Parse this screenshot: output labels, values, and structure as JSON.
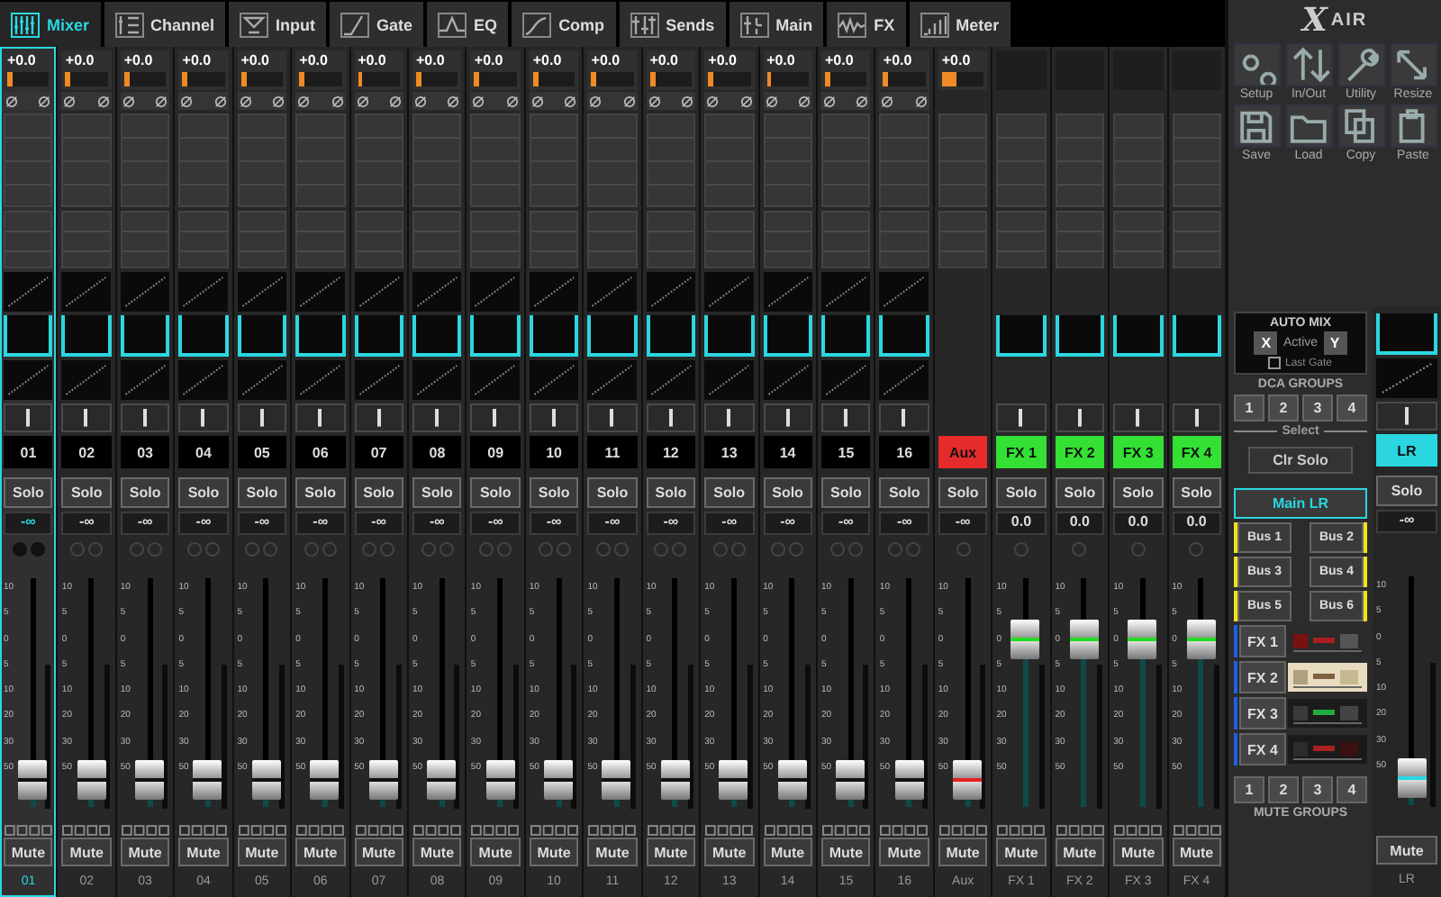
{
  "tabs": [
    {
      "label": "Mixer",
      "kind": "mixer",
      "selected": true
    },
    {
      "label": "Channel",
      "kind": "channel",
      "selected": false
    },
    {
      "label": "Input",
      "kind": "input",
      "selected": false
    },
    {
      "label": "Gate",
      "kind": "gate",
      "selected": false
    },
    {
      "label": "EQ",
      "kind": "eq",
      "selected": false
    },
    {
      "label": "Comp",
      "kind": "comp",
      "selected": false
    },
    {
      "label": "Sends",
      "kind": "sends",
      "selected": false
    },
    {
      "label": "Main",
      "kind": "main",
      "selected": false
    },
    {
      "label": "FX",
      "kind": "fx",
      "selected": false
    },
    {
      "label": "Meter",
      "kind": "meter",
      "selected": false
    }
  ],
  "logo": {
    "mark": "X",
    "text": "AIR"
  },
  "tools": [
    {
      "label": "Setup",
      "kind": "setup"
    },
    {
      "label": "In/Out",
      "kind": "inout"
    },
    {
      "label": "Utility",
      "kind": "utility"
    },
    {
      "label": "Resize",
      "kind": "resize"
    },
    {
      "label": "Save",
      "kind": "save"
    },
    {
      "label": "Load",
      "kind": "load"
    },
    {
      "label": "Copy",
      "kind": "copy"
    },
    {
      "label": "Paste",
      "kind": "paste"
    }
  ],
  "strips": [
    {
      "kind": "input",
      "label": "01",
      "selected": true,
      "gain": "+0.0",
      "meter": {
        "level": 0.12
      },
      "solo": "Solo",
      "value": "-∞",
      "scale": [
        "10",
        "5",
        "0",
        "5",
        "10",
        "20",
        "30",
        "50"
      ],
      "fader": {
        "level": 0.12
      },
      "mute": "Mute",
      "name": "01"
    },
    {
      "kind": "input",
      "label": "02",
      "selected": false,
      "gain": "+0.0",
      "meter": {
        "level": 0.12
      },
      "solo": "Solo",
      "value": "-∞",
      "scale": [
        "10",
        "5",
        "0",
        "5",
        "10",
        "20",
        "30",
        "50"
      ],
      "fader": {
        "level": 0.12
      },
      "mute": "Mute",
      "name": "02"
    },
    {
      "kind": "input",
      "label": "03",
      "selected": false,
      "gain": "+0.0",
      "meter": {
        "level": 0.12
      },
      "solo": "Solo",
      "value": "-∞",
      "scale": [
        "10",
        "5",
        "0",
        "5",
        "10",
        "20",
        "30",
        "50"
      ],
      "fader": {
        "level": 0.12
      },
      "mute": "Mute",
      "name": "03"
    },
    {
      "kind": "input",
      "label": "04",
      "selected": false,
      "gain": "+0.0",
      "meter": {
        "level": 0.12
      },
      "solo": "Solo",
      "value": "-∞",
      "scale": [
        "10",
        "5",
        "0",
        "5",
        "10",
        "20",
        "30",
        "50"
      ],
      "fader": {
        "level": 0.12
      },
      "mute": "Mute",
      "name": "04"
    },
    {
      "kind": "input",
      "label": "05",
      "selected": false,
      "gain": "+0.0",
      "meter": {
        "level": 0.12
      },
      "solo": "Solo",
      "value": "-∞",
      "scale": [
        "10",
        "5",
        "0",
        "5",
        "10",
        "20",
        "30",
        "50"
      ],
      "fader": {
        "level": 0.12
      },
      "mute": "Mute",
      "name": "05"
    },
    {
      "kind": "input",
      "label": "06",
      "selected": false,
      "gain": "+0.0",
      "meter": {
        "level": 0.12
      },
      "solo": "Solo",
      "value": "-∞",
      "scale": [
        "10",
        "5",
        "0",
        "5",
        "10",
        "20",
        "30",
        "50"
      ],
      "fader": {
        "level": 0.12
      },
      "mute": "Mute",
      "name": "06"
    },
    {
      "kind": "input",
      "label": "07",
      "selected": false,
      "gain": "+0.0",
      "meter": {
        "level": 0.12
      },
      "solo": "Solo",
      "value": "-∞",
      "scale": [
        "10",
        "5",
        "0",
        "5",
        "10",
        "20",
        "30",
        "50"
      ],
      "fader": {
        "level": 0.12
      },
      "mute": "Mute",
      "name": "07"
    },
    {
      "kind": "input",
      "label": "08",
      "selected": false,
      "gain": "+0.0",
      "meter": {
        "level": 0.12
      },
      "solo": "Solo",
      "value": "-∞",
      "scale": [
        "10",
        "5",
        "0",
        "5",
        "10",
        "20",
        "30",
        "50"
      ],
      "fader": {
        "level": 0.12
      },
      "mute": "Mute",
      "name": "08"
    },
    {
      "kind": "input",
      "label": "09",
      "selected": false,
      "gain": "+0.0",
      "meter": {
        "level": 0.12
      },
      "solo": "Solo",
      "value": "-∞",
      "scale": [
        "10",
        "5",
        "0",
        "5",
        "10",
        "20",
        "30",
        "50"
      ],
      "fader": {
        "level": 0.12
      },
      "mute": "Mute",
      "name": "09"
    },
    {
      "kind": "input",
      "label": "10",
      "selected": false,
      "gain": "+0.0",
      "meter": {
        "level": 0.12
      },
      "solo": "Solo",
      "value": "-∞",
      "scale": [
        "10",
        "5",
        "0",
        "5",
        "10",
        "20",
        "30",
        "50"
      ],
      "fader": {
        "level": 0.12
      },
      "mute": "Mute",
      "name": "10"
    },
    {
      "kind": "input",
      "label": "11",
      "selected": false,
      "gain": "+0.0",
      "meter": {
        "level": 0.12
      },
      "solo": "Solo",
      "value": "-∞",
      "scale": [
        "10",
        "5",
        "0",
        "5",
        "10",
        "20",
        "30",
        "50"
      ],
      "fader": {
        "level": 0.12
      },
      "mute": "Mute",
      "name": "11"
    },
    {
      "kind": "input",
      "label": "12",
      "selected": false,
      "gain": "+0.0",
      "meter": {
        "level": 0.12
      },
      "solo": "Solo",
      "value": "-∞",
      "scale": [
        "10",
        "5",
        "0",
        "5",
        "10",
        "20",
        "30",
        "50"
      ],
      "fader": {
        "level": 0.12
      },
      "mute": "Mute",
      "name": "12"
    },
    {
      "kind": "input",
      "label": "13",
      "selected": false,
      "gain": "+0.0",
      "meter": {
        "level": 0.12
      },
      "solo": "Solo",
      "value": "-∞",
      "scale": [
        "10",
        "5",
        "0",
        "5",
        "10",
        "20",
        "30",
        "50"
      ],
      "fader": {
        "level": 0.12
      },
      "mute": "Mute",
      "name": "13"
    },
    {
      "kind": "input",
      "label": "14",
      "selected": false,
      "gain": "+0.0",
      "meter": {
        "level": 0.12
      },
      "solo": "Solo",
      "value": "-∞",
      "scale": [
        "10",
        "5",
        "0",
        "5",
        "10",
        "20",
        "30",
        "50"
      ],
      "fader": {
        "level": 0.12
      },
      "mute": "Mute",
      "name": "14"
    },
    {
      "kind": "input",
      "label": "15",
      "selected": false,
      "gain": "+0.0",
      "meter": {
        "level": 0.12
      },
      "solo": "Solo",
      "value": "-∞",
      "scale": [
        "10",
        "5",
        "0",
        "5",
        "10",
        "20",
        "30",
        "50"
      ],
      "fader": {
        "level": 0.12
      },
      "mute": "Mute",
      "name": "15"
    },
    {
      "kind": "input",
      "label": "16",
      "selected": false,
      "gain": "+0.0",
      "meter": {
        "level": 0.12
      },
      "solo": "Solo",
      "value": "-∞",
      "scale": [
        "10",
        "5",
        "0",
        "5",
        "10",
        "20",
        "30",
        "50"
      ],
      "fader": {
        "level": 0.12
      },
      "mute": "Mute",
      "name": "16"
    },
    {
      "kind": "aux",
      "label": "Aux",
      "selected": false,
      "gain": "+0.0",
      "meter": {
        "level": 0.35
      },
      "solo": "Solo",
      "value": "-∞",
      "scale": [
        "10",
        "5",
        "0",
        "5",
        "10",
        "20",
        "30",
        "50"
      ],
      "fader": {
        "level": 0.12
      },
      "mute": "Mute",
      "name": "Aux"
    },
    {
      "kind": "fx",
      "label": "FX 1",
      "selected": false,
      "solo": "Solo",
      "value": "0.0",
      "scale": [
        "10",
        "5",
        "0",
        "5",
        "10",
        "20",
        "30",
        "50"
      ],
      "fader": {
        "level": 0.73
      },
      "mute": "Mute",
      "name": "FX 1"
    },
    {
      "kind": "fx",
      "label": "FX 2",
      "selected": false,
      "solo": "Solo",
      "value": "0.0",
      "scale": [
        "10",
        "5",
        "0",
        "5",
        "10",
        "20",
        "30",
        "50"
      ],
      "fader": {
        "level": 0.73
      },
      "mute": "Mute",
      "name": "FX 2"
    },
    {
      "kind": "fx",
      "label": "FX 3",
      "selected": false,
      "solo": "Solo",
      "value": "0.0",
      "scale": [
        "10",
        "5",
        "0",
        "5",
        "10",
        "20",
        "30",
        "50"
      ],
      "fader": {
        "level": 0.73
      },
      "mute": "Mute",
      "name": "FX 3"
    },
    {
      "kind": "fx",
      "label": "FX 4",
      "selected": false,
      "solo": "Solo",
      "value": "0.0",
      "scale": [
        "10",
        "5",
        "0",
        "5",
        "10",
        "20",
        "30",
        "50"
      ],
      "fader": {
        "level": 0.73
      },
      "mute": "Mute",
      "name": "FX 4"
    }
  ],
  "auto_mix": {
    "title": "AUTO MIX",
    "x": "X",
    "status": "Active",
    "y": "Y",
    "last_gate": {
      "label": "Last Gate",
      "checked": false
    }
  },
  "dca": {
    "title": "DCA GROUPS",
    "buttons": [
      "1",
      "2",
      "3",
      "4"
    ],
    "select": "Select",
    "clear_solo": "Clr Solo"
  },
  "main_lr": {
    "label": "Main LR",
    "selected": true
  },
  "buses": [
    {
      "label": "Bus 1",
      "color": "#f2e21c"
    },
    {
      "label": "Bus 2",
      "color": "#f2e21c"
    },
    {
      "label": "Bus 3",
      "color": "#f2e21c"
    },
    {
      "label": "Bus 4",
      "color": "#f2e21c"
    },
    {
      "label": "Bus 5",
      "color": "#f2e21c"
    },
    {
      "label": "Bus 6",
      "color": "#f2e21c"
    }
  ],
  "fx_returns": [
    {
      "label": "FX 1",
      "color": "#1e5ee8"
    },
    {
      "label": "FX 2",
      "color": "#1e5ee8"
    },
    {
      "label": "FX 3",
      "color": "#1e5ee8"
    },
    {
      "label": "FX 4",
      "color": "#1e5ee8"
    }
  ],
  "mute_groups": {
    "buttons": [
      "1",
      "2",
      "3",
      "4"
    ],
    "title": "MUTE GROUPS"
  },
  "main_strip": {
    "label": "LR",
    "solo": "Solo",
    "value": "-∞",
    "scale": [
      "10",
      "5",
      "0",
      "5",
      "10",
      "20",
      "30",
      "50"
    ],
    "fader": {
      "level": 0.12
    },
    "mute": "Mute",
    "name": "LR"
  }
}
